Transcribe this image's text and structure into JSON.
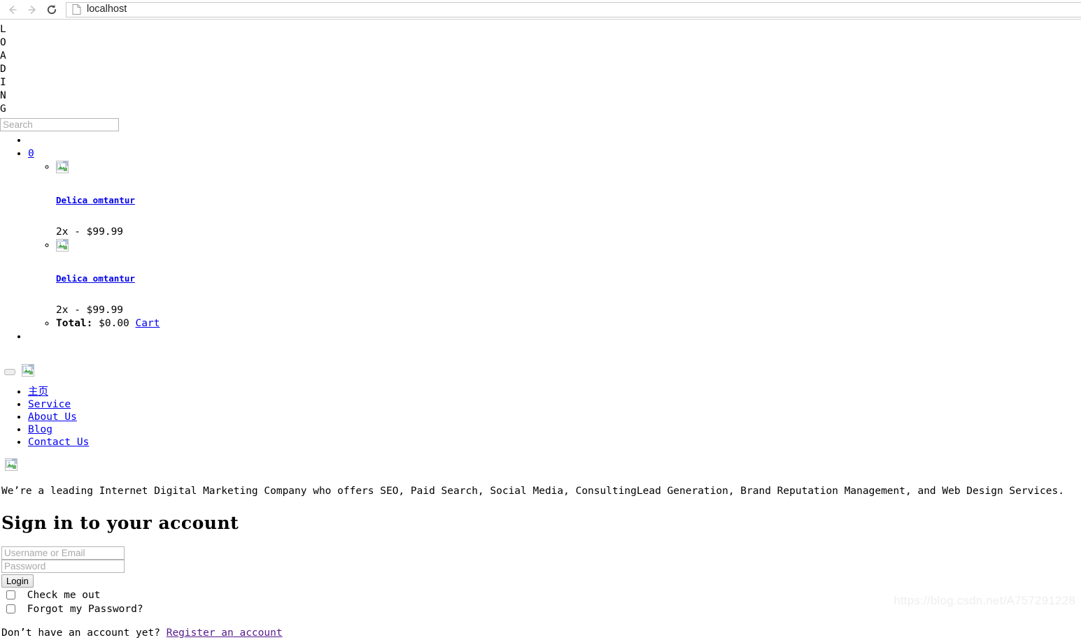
{
  "browser": {
    "back_icon": "arrow-left-icon",
    "forward_icon": "arrow-right-icon",
    "reload_icon": "reload-icon",
    "page_icon": "page-document-icon",
    "url": "localhost"
  },
  "page": {
    "loading_text": "LOADING",
    "search": {
      "placeholder": "Search",
      "value": ""
    },
    "cart": {
      "count_label": "0",
      "items": [
        {
          "thumb_icon": "broken-image-icon",
          "title": "Delica omtantur",
          "price_line": "2x - $99.99"
        },
        {
          "thumb_icon": "broken-image-icon",
          "title": "Delica omtantur",
          "price_line": "2x - $99.99"
        }
      ],
      "total_label": "Total:",
      "total_value": "$0.00",
      "cart_link": "Cart"
    },
    "brand": {
      "toggle_icon": "navbar-toggle-icon",
      "logo_icon": "broken-image-icon"
    },
    "nav_items": [
      {
        "label": "主页",
        "cjk": true
      },
      {
        "label": "Service",
        "cjk": false
      },
      {
        "label": "About Us",
        "cjk": false
      },
      {
        "label": "Blog",
        "cjk": false
      },
      {
        "label": "Contact Us",
        "cjk": false
      }
    ],
    "footer_logo_icon": "broken-image-icon",
    "tagline": "We’re a leading Internet Digital Marketing Company who offers SEO, Paid Search, Social Media, ConsultingLead Generation, Brand Reputation Management, and Web Design Services.",
    "signin": {
      "heading": "Sign in to your account",
      "username_placeholder": "Username or Email",
      "username_value": "",
      "password_placeholder": "Password",
      "password_value": "",
      "login_label": "Login",
      "check_me_out_label": "Check me out",
      "forgot_password_label": "Forgot my Password?",
      "register_prompt": "Don’t have an account yet?",
      "register_link": "Register an account"
    },
    "watermark": "https://blog.csdn.net/A757291228"
  },
  "colors": {
    "link": "#0000ee",
    "visited_link": "#551a8b",
    "text": "#000000",
    "placeholder": "#a8a8a8"
  }
}
